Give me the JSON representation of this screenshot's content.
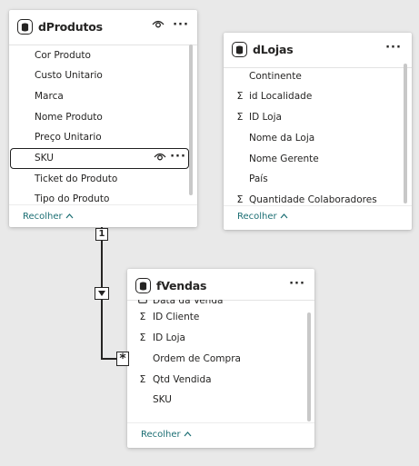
{
  "tables": {
    "dprodutos": {
      "title": "dProdutos",
      "fields": [
        {
          "name": "Cor Produto",
          "sigma": false
        },
        {
          "name": "Custo Unitario",
          "sigma": false
        },
        {
          "name": "Marca",
          "sigma": false
        },
        {
          "name": "Nome Produto",
          "sigma": false
        },
        {
          "name": "Preço Unitario",
          "sigma": false
        },
        {
          "name": "SKU",
          "sigma": false,
          "selected": true
        },
        {
          "name": "Ticket do Produto",
          "sigma": false
        },
        {
          "name": "Tipo do Produto",
          "sigma": false
        }
      ],
      "collapse_label": "Recolher"
    },
    "dlojas": {
      "title": "dLojas",
      "fields": [
        {
          "name": "Continente",
          "sigma": false
        },
        {
          "name": "id Localidade",
          "sigma": true
        },
        {
          "name": "ID Loja",
          "sigma": true
        },
        {
          "name": "Nome da Loja",
          "sigma": false
        },
        {
          "name": "Nome Gerente",
          "sigma": false
        },
        {
          "name": "País",
          "sigma": false
        },
        {
          "name": "Quantidade Colaboradores",
          "sigma": true
        }
      ],
      "collapse_label": "Recolher"
    },
    "fvendas": {
      "title": "fVendas",
      "fields": [
        {
          "name": "Data da Venda",
          "sigma": false,
          "icon": "calendar-icon"
        },
        {
          "name": "ID Cliente",
          "sigma": true
        },
        {
          "name": "ID Loja",
          "sigma": true
        },
        {
          "name": "Ordem de Compra",
          "sigma": false
        },
        {
          "name": "Qtd Vendida",
          "sigma": true
        },
        {
          "name": "SKU",
          "sigma": false
        }
      ],
      "collapse_label": "Recolher"
    }
  },
  "relationship": {
    "from_cardinality": "1",
    "to_cardinality": "*",
    "direction_icon": "triangle-down-icon"
  },
  "icons": {
    "table": "table-icon",
    "visibility": "eye-icon",
    "more": "more-options-icon",
    "sum": "sigma-icon",
    "collapse": "chevron-up-icon"
  },
  "colors": {
    "canvas": "#e9e9e9",
    "card": "#ffffff",
    "link": "#1b6e73",
    "border": "#252423"
  }
}
